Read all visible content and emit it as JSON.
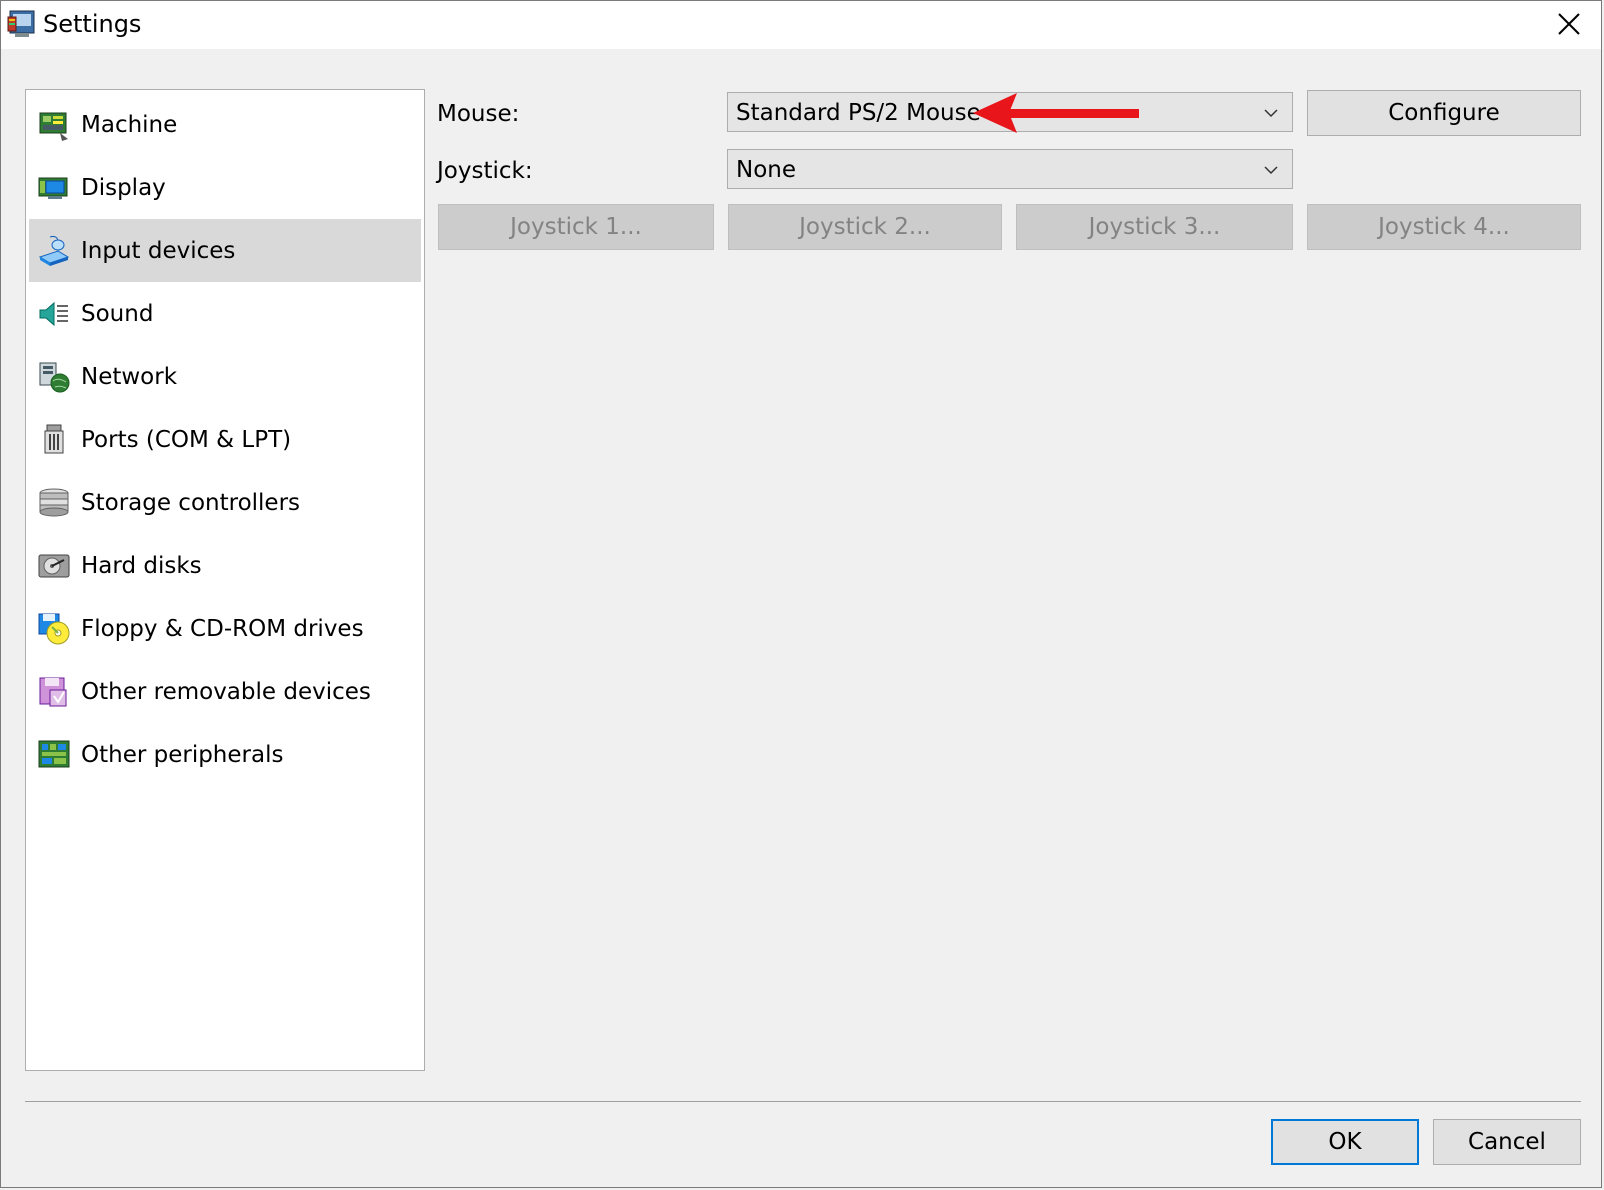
{
  "window": {
    "title": "Settings",
    "app_icon": "settings-app-icon",
    "close_icon": "close-icon"
  },
  "nav": {
    "selected_index": 2,
    "items": [
      {
        "label": "Machine",
        "icon": "machine-icon"
      },
      {
        "label": "Display",
        "icon": "display-icon"
      },
      {
        "label": "Input devices",
        "icon": "input-devices-icon"
      },
      {
        "label": "Sound",
        "icon": "sound-icon"
      },
      {
        "label": "Network",
        "icon": "network-icon"
      },
      {
        "label": "Ports (COM & LPT)",
        "icon": "ports-icon"
      },
      {
        "label": "Storage controllers",
        "icon": "storage-controllers-icon"
      },
      {
        "label": "Hard disks",
        "icon": "hard-disk-icon"
      },
      {
        "label": "Floppy & CD-ROM drives",
        "icon": "floppy-cdrom-icon"
      },
      {
        "label": "Other removable devices",
        "icon": "removable-devices-icon"
      },
      {
        "label": "Other peripherals",
        "icon": "peripherals-icon"
      }
    ]
  },
  "input": {
    "mouse_label": "Mouse:",
    "mouse_value": "Standard PS/2 Mouse",
    "configure_label": "Configure",
    "joystick_label": "Joystick:",
    "joystick_value": "None",
    "joystick_buttons": [
      "Joystick 1...",
      "Joystick 2...",
      "Joystick 3...",
      "Joystick 4..."
    ]
  },
  "footer": {
    "ok_label": "OK",
    "cancel_label": "Cancel"
  },
  "colors": {
    "annotation_arrow": "#e8151b",
    "selected_bg": "#d9d9d9",
    "default_button_border": "#0078d7"
  }
}
